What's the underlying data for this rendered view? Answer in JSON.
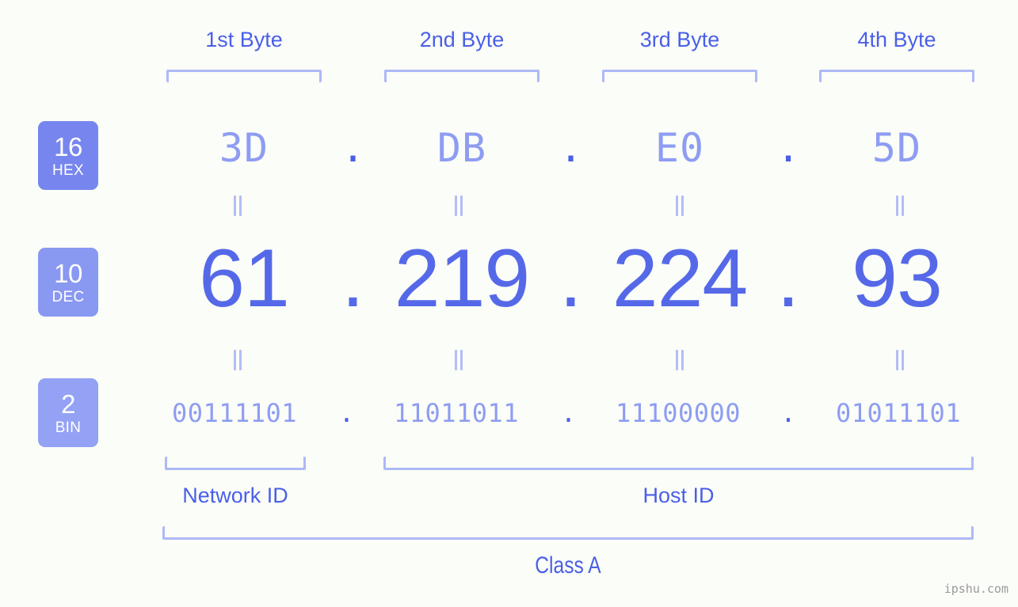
{
  "watermark": "ipshu.com",
  "byte_headers": [
    {
      "label": "1st Byte"
    },
    {
      "label": "2nd Byte"
    },
    {
      "label": "3rd Byte"
    },
    {
      "label": "4th Byte"
    }
  ],
  "radix_badges": [
    {
      "number": "16",
      "system": "HEX",
      "color": "#7786ee"
    },
    {
      "number": "10",
      "system": "DEC",
      "color": "#8998f1"
    },
    {
      "number": "2",
      "system": "BIN",
      "color": "#93a2f4"
    }
  ],
  "rows": {
    "hex": {
      "octets": [
        "3D",
        "DB",
        "E0",
        "5D"
      ],
      "separator": "."
    },
    "dec": {
      "octets": [
        "61",
        "219",
        "224",
        "93"
      ],
      "separator": "."
    },
    "bin": {
      "octets": [
        "00111101",
        "11011011",
        "11100000",
        "01011101"
      ],
      "separator": "."
    }
  },
  "equals_marker": "=",
  "regions": [
    {
      "label": "Network ID"
    },
    {
      "label": "Host ID"
    }
  ],
  "class": {
    "label": "Class A"
  },
  "colors": {
    "background": "#fbfdf8",
    "accent_strong": "#5569e8",
    "accent_light": "#8e9df2",
    "bracket": "#adb9f7",
    "label": "#4a5fe8",
    "watermark": "#9a9a9a"
  }
}
